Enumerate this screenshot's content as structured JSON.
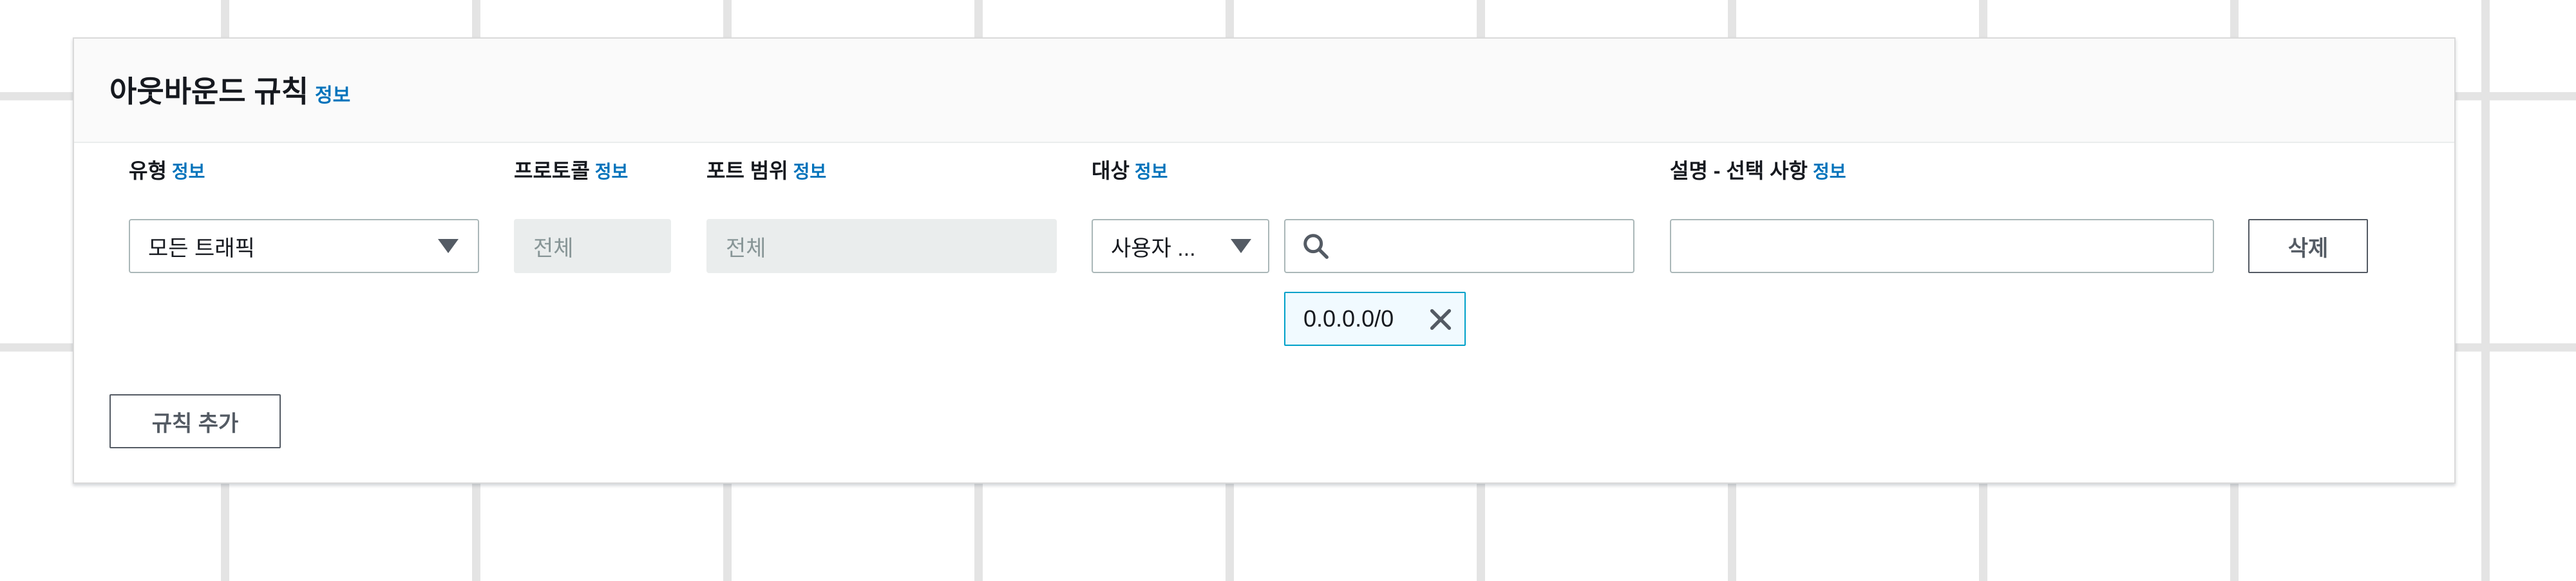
{
  "section": {
    "title": "아웃바운드 규칙",
    "info": "정보"
  },
  "columns": {
    "type": {
      "label": "유형",
      "info": "정보"
    },
    "protocol": {
      "label": "프로토콜",
      "info": "정보"
    },
    "port_range": {
      "label": "포트 범위",
      "info": "정보"
    },
    "destination": {
      "label": "대상",
      "info": "정보"
    },
    "description": {
      "label": "설명 - 선택 사항",
      "info": "정보"
    }
  },
  "rule": {
    "type_value": "모든 트래픽",
    "protocol_value": "전체",
    "port_range_value": "전체",
    "destination_type": "사용자 ...",
    "destination_search_value": "",
    "destination_token": "0.0.0.0/0",
    "description_value": "",
    "delete_label": "삭제"
  },
  "actions": {
    "add_rule_label": "규칙 추가"
  },
  "icons": {
    "type_caret": "caret-down-icon",
    "destination_caret": "caret-down-icon",
    "search": "search-icon",
    "token_remove": "close-icon"
  },
  "colors": {
    "info_link": "#0073bb",
    "token_border": "#00a1c9",
    "token_bg": "#f1faff",
    "disabled_bg": "#eaeded"
  }
}
